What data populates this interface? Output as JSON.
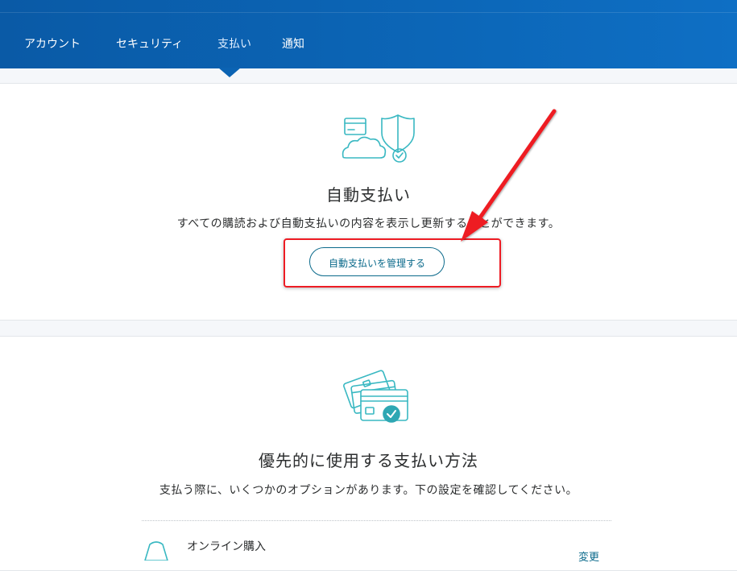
{
  "nav": {
    "items": [
      {
        "label": "アカウント"
      },
      {
        "label": "セキュリティ"
      },
      {
        "label": "支払い"
      },
      {
        "label": "通知"
      }
    ],
    "active": "支払い"
  },
  "auto_payments": {
    "icon": "cloud-card-shield-icon",
    "title": "自動支払い",
    "description": "すべての購読および自動支払いの内容を表示し更新することができます。",
    "button_label": "自動支払いを管理する"
  },
  "preferred": {
    "icon": "cards-check-icon",
    "title": "優先的に使用する支払い方法",
    "description": "支払う際に、いくつかのオプションがあります。下の設定を確認してください。",
    "option_label": "オンライン購入",
    "change_label": "変更"
  },
  "colors": {
    "header": "#0b63b3",
    "accent": "#0b6a8b",
    "annotation": "#ee1c24",
    "icon_teal": "#39b8c2"
  }
}
